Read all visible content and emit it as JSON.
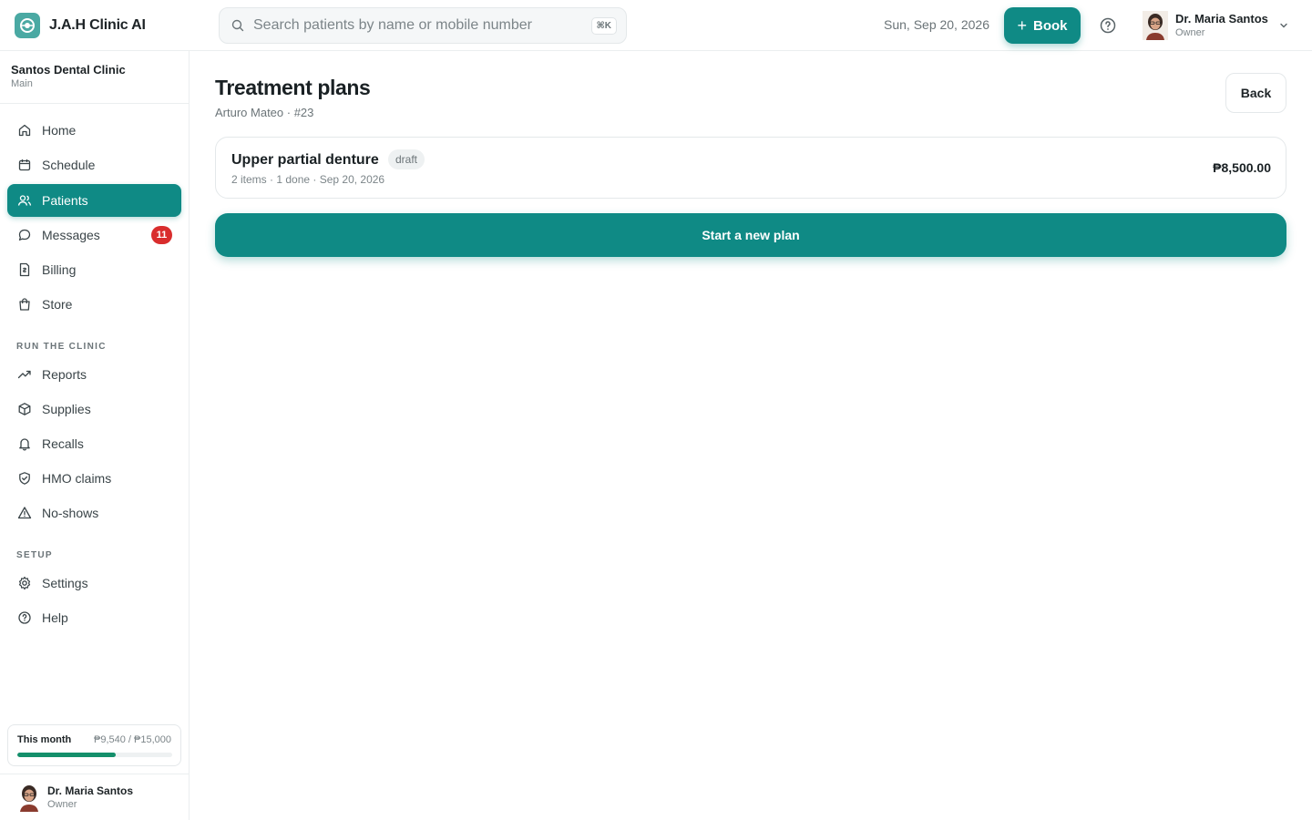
{
  "app": {
    "title": "J.A.H Clinic AI"
  },
  "search": {
    "placeholder": "Search patients by name or mobile number",
    "shortcut": "⌘K"
  },
  "header": {
    "date": "Sun, Sep 20, 2026",
    "book_label": "Book",
    "user_name": "Dr. Maria Santos",
    "user_role": "Owner"
  },
  "clinic": {
    "name": "Santos Dental Clinic",
    "branch": "Main"
  },
  "sidebar": {
    "main_items": [
      {
        "label": "Home",
        "icon": "home-icon"
      },
      {
        "label": "Schedule",
        "icon": "calendar-icon"
      },
      {
        "label": "Patients",
        "icon": "users-icon",
        "active": true
      },
      {
        "label": "Messages",
        "icon": "message-icon",
        "badge": "11"
      },
      {
        "label": "Billing",
        "icon": "billing-icon"
      },
      {
        "label": "Store",
        "icon": "shopping-bag-icon"
      }
    ],
    "run_section_label": "RUN THE CLINIC",
    "run_items": [
      {
        "label": "Reports",
        "icon": "trending-up-icon"
      },
      {
        "label": "Supplies",
        "icon": "box-icon"
      },
      {
        "label": "Recalls",
        "icon": "bell-icon"
      },
      {
        "label": "HMO claims",
        "icon": "shield-icon"
      },
      {
        "label": "No-shows",
        "icon": "warning-icon"
      }
    ],
    "setup_section_label": "SETUP",
    "setup_items": [
      {
        "label": "Settings",
        "icon": "gear-icon"
      },
      {
        "label": "Help",
        "icon": "help-icon"
      }
    ],
    "month": {
      "label": "This month",
      "value": "₱9,540 / ₱15,000",
      "progress": 0.636
    },
    "user": {
      "name": "Dr. Maria Santos",
      "role": "Owner"
    }
  },
  "main": {
    "title": "Treatment plans",
    "subtitle": "Arturo Mateo · #23",
    "back_label": "Back",
    "plans": [
      {
        "name": "Upper partial denture",
        "status": "draft",
        "meta": "2 items · 1 done · Sep 20, 2026",
        "amount": "₱8,500.00"
      }
    ],
    "new_plan_label": "Start a new plan"
  },
  "colors": {
    "accent": "#0f8a85",
    "badge": "#d92d2d",
    "progress": "#148f6b"
  }
}
